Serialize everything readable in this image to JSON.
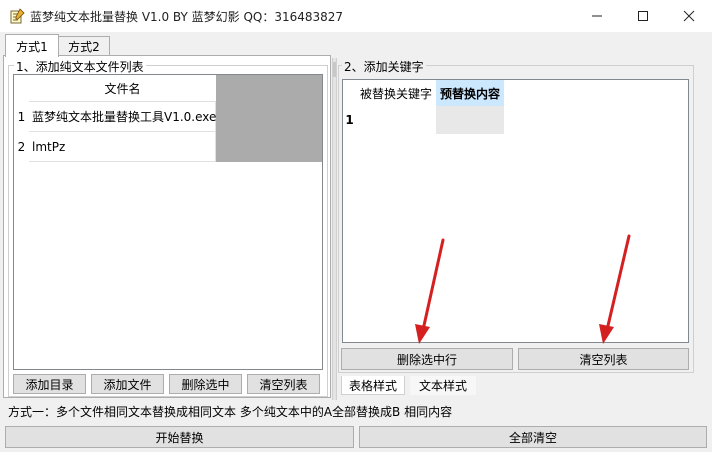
{
  "window": {
    "title": "蓝梦纯文本批量替换 V1.0 BY 蓝梦幻影 QQ：316483827",
    "icon": "notepad-icon"
  },
  "tabs": [
    {
      "label": "方式1",
      "active": true
    },
    {
      "label": "方式2",
      "active": false
    }
  ],
  "file_group": {
    "title": "1、添加纯文本文件列表",
    "column_header": "文件名",
    "rows": [
      {
        "num": "1",
        "name": "蓝梦纯文本批量替换工具V1.0.exe"
      },
      {
        "num": "2",
        "name": "lmtPz"
      }
    ],
    "buttons": [
      "添加目录",
      "添加文件",
      "删除选中",
      "清空列表"
    ]
  },
  "keyword_group": {
    "title": "2、添加关键字",
    "headers": [
      "被替换关键字",
      "预替换内容"
    ],
    "rows": [
      {
        "num": "1",
        "key": "",
        "value": ""
      }
    ],
    "delete_row_label": "删除选中行",
    "clear_list_label": "清空列表",
    "style_tabs": [
      "表格样式",
      "文本样式"
    ]
  },
  "status": "方式一：多个文件相同文本替换成相同文本    多个纯文本中的A全部替换成B  相同内容",
  "bottom_buttons": {
    "start": "开始替换",
    "clear_all": "全部清空"
  },
  "colors": {
    "grid_background": "#ababab",
    "annotation_arrow": "#d42020",
    "selected_header": "#cce8ff"
  }
}
